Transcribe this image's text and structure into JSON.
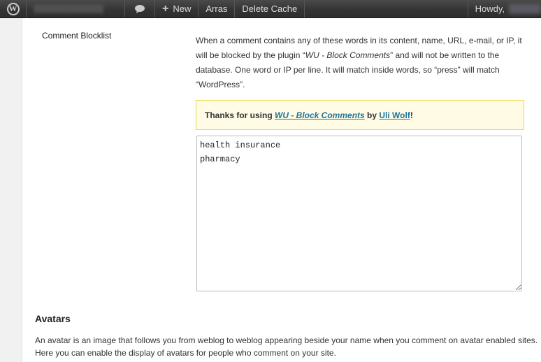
{
  "adminbar": {
    "wp_logo_icon": "wordpress-logo-icon",
    "site_name_blurred": true,
    "comments_icon": "speech-bubble-icon",
    "new_plus": "+",
    "new_label": "New",
    "arras_label": "Arras",
    "delete_cache_label": "Delete Cache",
    "howdy_label": "Howdy,"
  },
  "setting": {
    "label": "Comment Blocklist",
    "desc_1": "When a comment contains any of these words in its content, name, URL, e-mail, or IP, it will be blocked by the plugin “",
    "plugin_name": "WU - Block Comments",
    "desc_2": "” and will not be written to the database. One word or IP per line. It will match inside words, so “press” will match “WordPress”.",
    "notice_prefix": "Thanks for using ",
    "notice_plugin": "WU - Block Comments",
    "notice_by": " by ",
    "notice_author": "Uli Wolf",
    "notice_suffix": "!",
    "textarea_value": "health insurance\npharmacy"
  },
  "avatars": {
    "title": "Avatars",
    "description": "An avatar is an image that follows you from weblog to weblog appearing beside your name when you comment on avatar enabled sites. Here you can enable the display of avatars for people who comment on your site."
  },
  "colors": {
    "adminbar_bg": "#333333",
    "link": "#21759b",
    "notice_bg": "#fffbe5",
    "notice_border": "#e6db55"
  }
}
